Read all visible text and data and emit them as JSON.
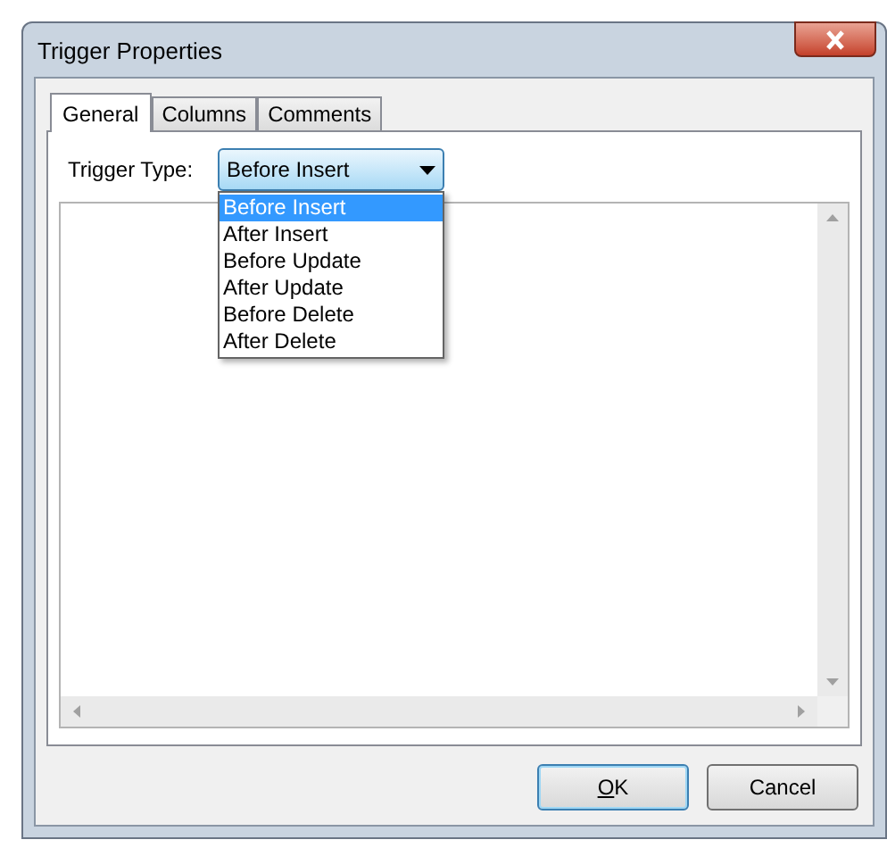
{
  "window": {
    "title": "Trigger Properties"
  },
  "tabs": [
    {
      "label": "General",
      "selected": true
    },
    {
      "label": "Columns",
      "selected": false
    },
    {
      "label": "Comments",
      "selected": false
    }
  ],
  "trigger_type": {
    "label": "Trigger Type:",
    "value": "Before Insert",
    "expanded": true,
    "options": [
      {
        "label": "Before Insert",
        "selected": true
      },
      {
        "label": "After Insert",
        "selected": false
      },
      {
        "label": "Before Update",
        "selected": false
      },
      {
        "label": "After Update",
        "selected": false
      },
      {
        "label": "Before Delete",
        "selected": false
      },
      {
        "label": "After Delete",
        "selected": false
      }
    ]
  },
  "buttons": [
    {
      "label": "OK",
      "default": true,
      "mnemonic_underlined": true
    },
    {
      "label": "Cancel",
      "default": false,
      "mnemonic_underlined": false
    }
  ]
}
